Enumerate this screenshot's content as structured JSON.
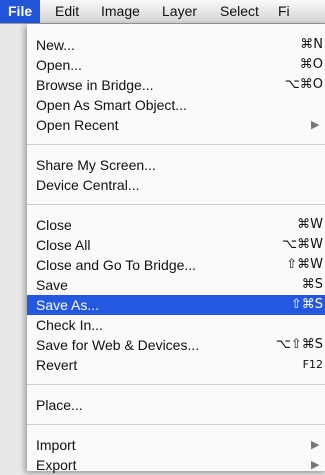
{
  "menubar": {
    "items": [
      "File",
      "Edit",
      "Image",
      "Layer",
      "Select",
      "Fi"
    ]
  },
  "file_menu": {
    "new": {
      "label": "New...",
      "shortcut": "⌘N"
    },
    "open": {
      "label": "Open...",
      "shortcut": "⌘O"
    },
    "browse": {
      "label": "Browse in Bridge...",
      "shortcut": "⌥⌘O"
    },
    "smart": {
      "label": "Open As Smart Object..."
    },
    "recent": {
      "label": "Open Recent",
      "submenu_icon": "triangle-right-icon"
    },
    "share": {
      "label": "Share My Screen..."
    },
    "device": {
      "label": "Device Central..."
    },
    "close": {
      "label": "Close",
      "shortcut": "⌘W"
    },
    "close_all": {
      "label": "Close All",
      "shortcut": "⌥⌘W"
    },
    "close_bridge": {
      "label": "Close and Go To Bridge...",
      "shortcut": "⇧⌘W"
    },
    "save": {
      "label": "Save",
      "shortcut": "⌘S"
    },
    "save_as": {
      "label": "Save As...",
      "shortcut": "⇧⌘S",
      "highlighted": true
    },
    "check_in": {
      "label": "Check In..."
    },
    "save_web": {
      "label": "Save for Web & Devices...",
      "shortcut": "⌥⇧⌘S"
    },
    "revert": {
      "label": "Revert",
      "shortcut": "F12"
    },
    "place": {
      "label": "Place..."
    },
    "import": {
      "label": "Import",
      "submenu_icon": "triangle-right-icon"
    },
    "export": {
      "label": "Export",
      "submenu_icon": "triangle-right-icon"
    }
  },
  "colors": {
    "highlight": "#2558e0",
    "menu_background": "#fafafa"
  }
}
